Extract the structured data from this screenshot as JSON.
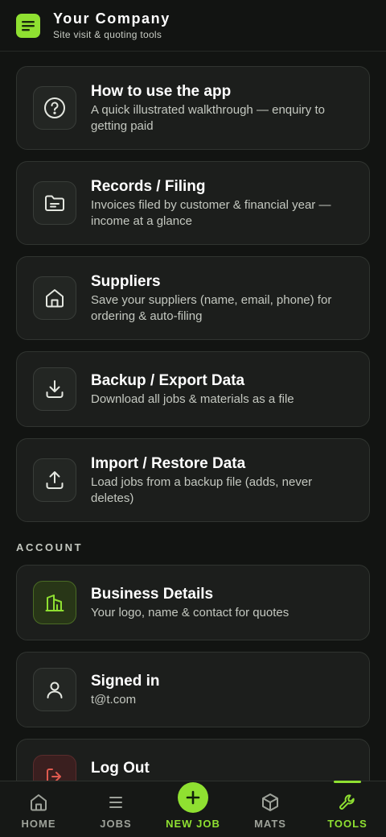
{
  "header": {
    "title": "Your Company",
    "subtitle": "Site visit & quoting tools"
  },
  "tools": [
    {
      "title": "How to use the app",
      "desc": "A quick illustrated walkthrough — enquiry to getting paid",
      "icon": "help-circle-icon"
    },
    {
      "title": "Records / Filing",
      "desc": "Invoices filed by customer & financial year — income at a glance",
      "icon": "folder-icon"
    },
    {
      "title": "Suppliers",
      "desc": "Save your suppliers (name, email, phone) for ordering & auto-filing",
      "icon": "store-icon"
    },
    {
      "title": "Backup / Export Data",
      "desc": "Download all jobs & materials as a file",
      "icon": "download-icon"
    },
    {
      "title": "Import / Restore Data",
      "desc": "Load jobs from a backup file (adds, never deletes)",
      "icon": "upload-icon"
    }
  ],
  "account": {
    "section_label": "ACCOUNT",
    "business": {
      "title": "Business Details",
      "desc": "Your logo, name & contact for quotes",
      "icon": "building-icon"
    },
    "signed_in": {
      "title": "Signed in",
      "desc": "t@t.com",
      "icon": "user-icon"
    },
    "logout": {
      "title": "Log Out",
      "icon": "logout-icon"
    }
  },
  "tabbar": {
    "home": "HOME",
    "jobs": "JOBS",
    "new_job": "NEW JOB",
    "mats": "MATS",
    "tools": "TOOLS",
    "active": "tools"
  },
  "colors": {
    "accent": "#8fe031",
    "background": "#121412",
    "card": "#1c1e1c",
    "logout_red": "#e05a4f"
  }
}
